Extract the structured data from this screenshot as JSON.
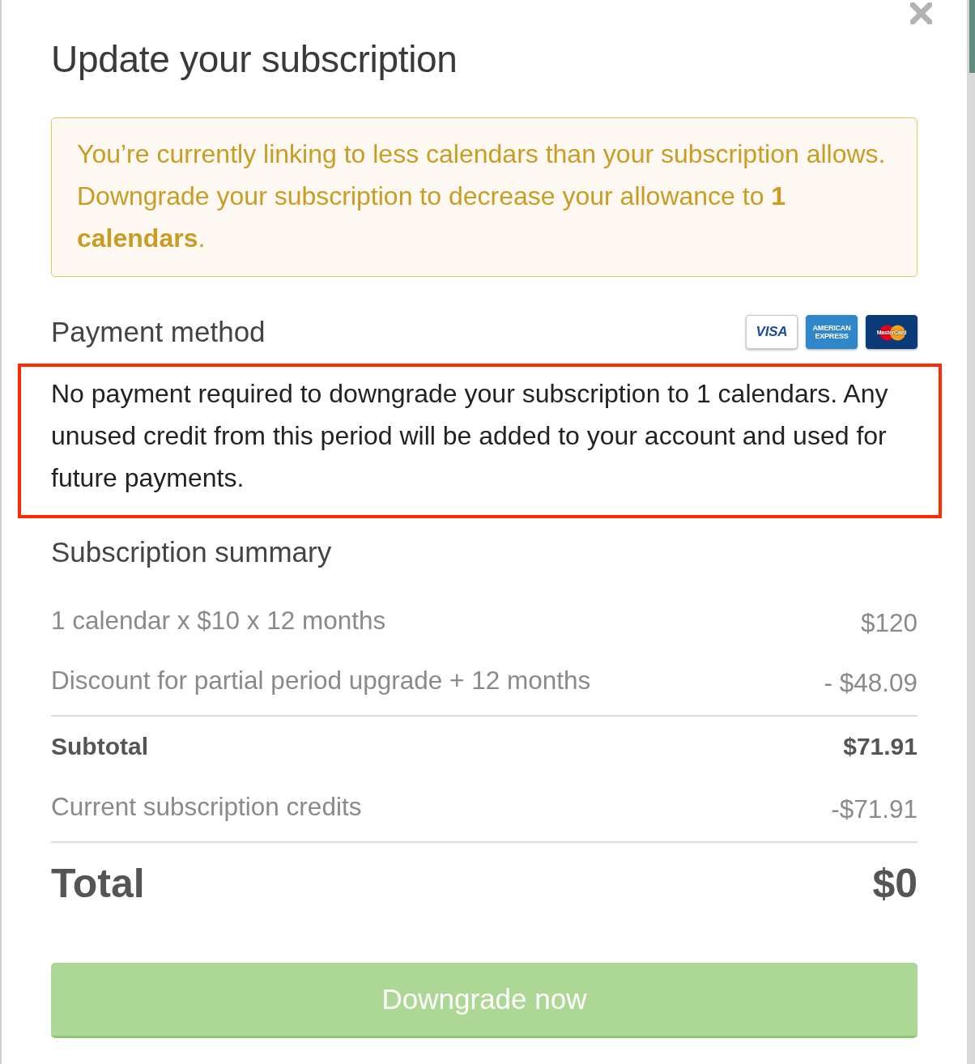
{
  "dialog": {
    "title": "Update your subscription",
    "notice": {
      "text": "You’re currently linking to less calendars than your subscription allows. Downgrade your subscription to decrease your allowance to **1 calendars**."
    },
    "payment": {
      "heading": "Payment method",
      "cards": [
        {
          "kind": "visa",
          "label": "VISA"
        },
        {
          "kind": "amex",
          "label": "AMERICAN EXPRESS"
        },
        {
          "kind": "mastercard",
          "label": "MasterCard"
        }
      ],
      "message": "No payment required to downgrade your subscription to 1 calendars. Any unused credit from this period will be added to your account and used for future payments.",
      "highlighted": true
    },
    "summary": {
      "heading": "Subscription summary",
      "rows": [
        {
          "kind": "line",
          "label": "1 calendar x $10 x 12 months",
          "amount": "$120"
        },
        {
          "kind": "line",
          "label": "Discount for partial period upgrade + 12 months",
          "amount": "- $48.09"
        },
        {
          "kind": "subtotal",
          "label": "Subtotal",
          "amount": "$71.91"
        },
        {
          "kind": "line",
          "label": "Current subscription credits",
          "amount": "-$71.91"
        },
        {
          "kind": "total",
          "label": "Total",
          "amount": "$0"
        }
      ]
    },
    "button": {
      "label": "Downgrade now"
    }
  }
}
